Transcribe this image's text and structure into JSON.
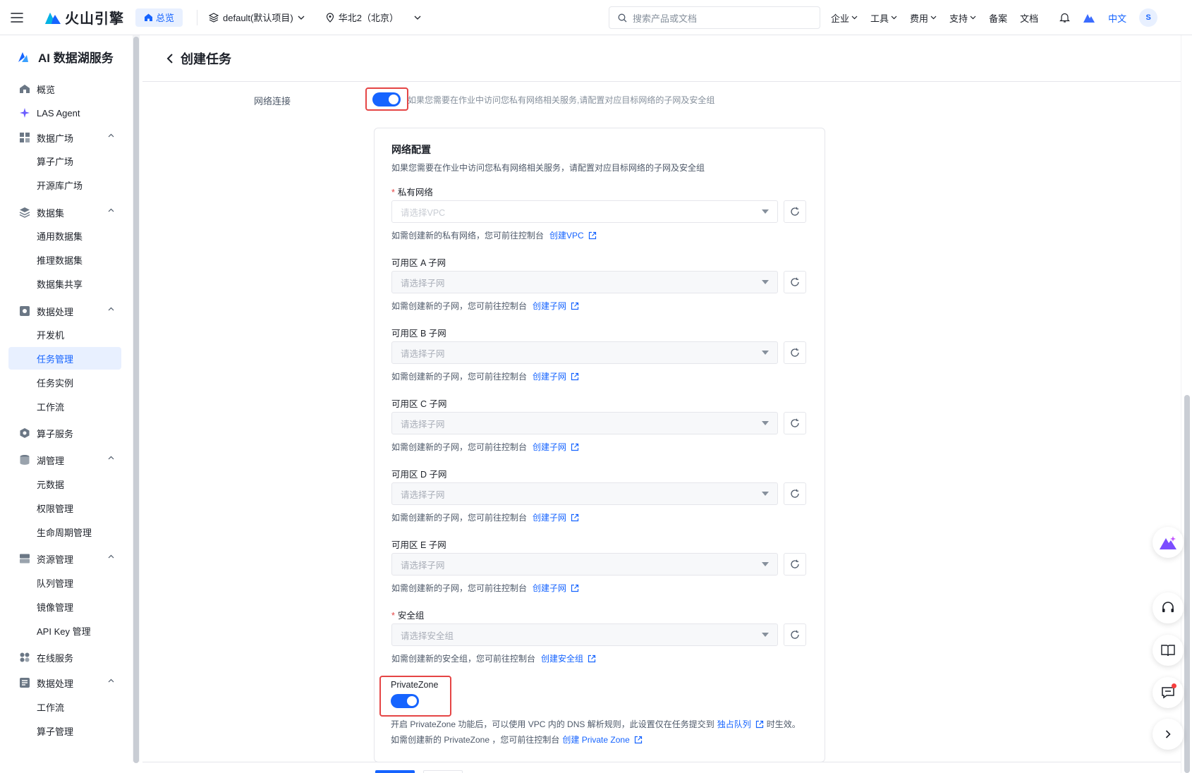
{
  "topbar": {
    "brand": "火山引擎",
    "home": "总览",
    "project": "default(默认项目)",
    "region": "华北2（北京）",
    "search_placeholder": "搜索产品或文档",
    "menus": [
      "企业",
      "工具",
      "费用",
      "支持"
    ],
    "links": [
      "备案",
      "文档"
    ],
    "lang": "中文",
    "avatar": "S"
  },
  "sidebar": {
    "title": "AI 数据湖服务",
    "items": [
      {
        "label": "概览",
        "icon": "home-icon"
      },
      {
        "label": "LAS Agent",
        "icon": "sparkle-icon"
      },
      {
        "label": "数据广场",
        "icon": "grid-icon"
      },
      {
        "label": "算子广场"
      },
      {
        "label": "开源库广场"
      },
      {
        "label": "数据集",
        "icon": "layers-icon"
      },
      {
        "label": "通用数据集"
      },
      {
        "label": "推理数据集"
      },
      {
        "label": "数据集共享"
      },
      {
        "label": "数据处理",
        "icon": "processing-icon"
      },
      {
        "label": "开发机"
      },
      {
        "label": "任务管理"
      },
      {
        "label": "任务实例"
      },
      {
        "label": "工作流"
      },
      {
        "label": "算子服务",
        "icon": "operator-icon"
      },
      {
        "label": "湖管理",
        "icon": "database-icon"
      },
      {
        "label": "元数据"
      },
      {
        "label": "权限管理"
      },
      {
        "label": "生命周期管理"
      },
      {
        "label": "资源管理",
        "icon": "server-icon"
      },
      {
        "label": "队列管理"
      },
      {
        "label": "镜像管理"
      },
      {
        "label": "API Key 管理"
      },
      {
        "label": "在线服务",
        "icon": "apps-icon"
      },
      {
        "label": "数据处理",
        "icon": "processing-icon"
      },
      {
        "label": "工作流"
      },
      {
        "label": "算子管理"
      }
    ]
  },
  "header": {
    "title": "创建任务"
  },
  "network": {
    "label": "网络连接",
    "hint": "如果您需要在作业中访问您私有网络相关服务,请配置对应目标网络的子网及安全组",
    "enabled": true
  },
  "config": {
    "title": "网络配置",
    "desc": "如果您需要在作业中访问您私有网络相关服务，请配置对应目标网络的子网及安全组",
    "fields": [
      {
        "label": "私有网络",
        "required": true,
        "placeholder": "请选择VPC",
        "help": "如需创建新的私有网络，您可前往控制台",
        "link": "创建VPC",
        "disabled": false
      },
      {
        "label": "可用区 A 子网",
        "required": false,
        "placeholder": "请选择子网",
        "help": "如需创建新的子网，您可前往控制台",
        "link": "创建子网",
        "disabled": true
      },
      {
        "label": "可用区 B 子网",
        "required": false,
        "placeholder": "请选择子网",
        "help": "如需创建新的子网，您可前往控制台",
        "link": "创建子网",
        "disabled": true
      },
      {
        "label": "可用区 C 子网",
        "required": false,
        "placeholder": "请选择子网",
        "help": "如需创建新的子网，您可前往控制台",
        "link": "创建子网",
        "disabled": true
      },
      {
        "label": "可用区 D 子网",
        "required": false,
        "placeholder": "请选择子网",
        "help": "如需创建新的子网，您可前往控制台",
        "link": "创建子网",
        "disabled": true
      },
      {
        "label": "可用区 E 子网",
        "required": false,
        "placeholder": "请选择子网",
        "help": "如需创建新的子网，您可前往控制台",
        "link": "创建子网",
        "disabled": true
      },
      {
        "label": "安全组",
        "required": true,
        "placeholder": "请选择安全组",
        "help": "如需创建新的安全组，您可前往控制台",
        "link": "创建安全组",
        "disabled": true
      }
    ]
  },
  "privatezone": {
    "label": "PrivateZone",
    "enabled": true,
    "desc_before": "开启 PrivateZone 功能后，可以使用 VPC 内的 DNS 解析规则，此设置仅在任务提交到",
    "desc_link": "独占队列",
    "desc_after": "时生效。",
    "help": "如需创建新的 PrivateZone ，您可前往控制台",
    "help_link": "创建 Private Zone"
  },
  "colors": {
    "primary": "#1664ff",
    "highlight": "#e54545"
  }
}
